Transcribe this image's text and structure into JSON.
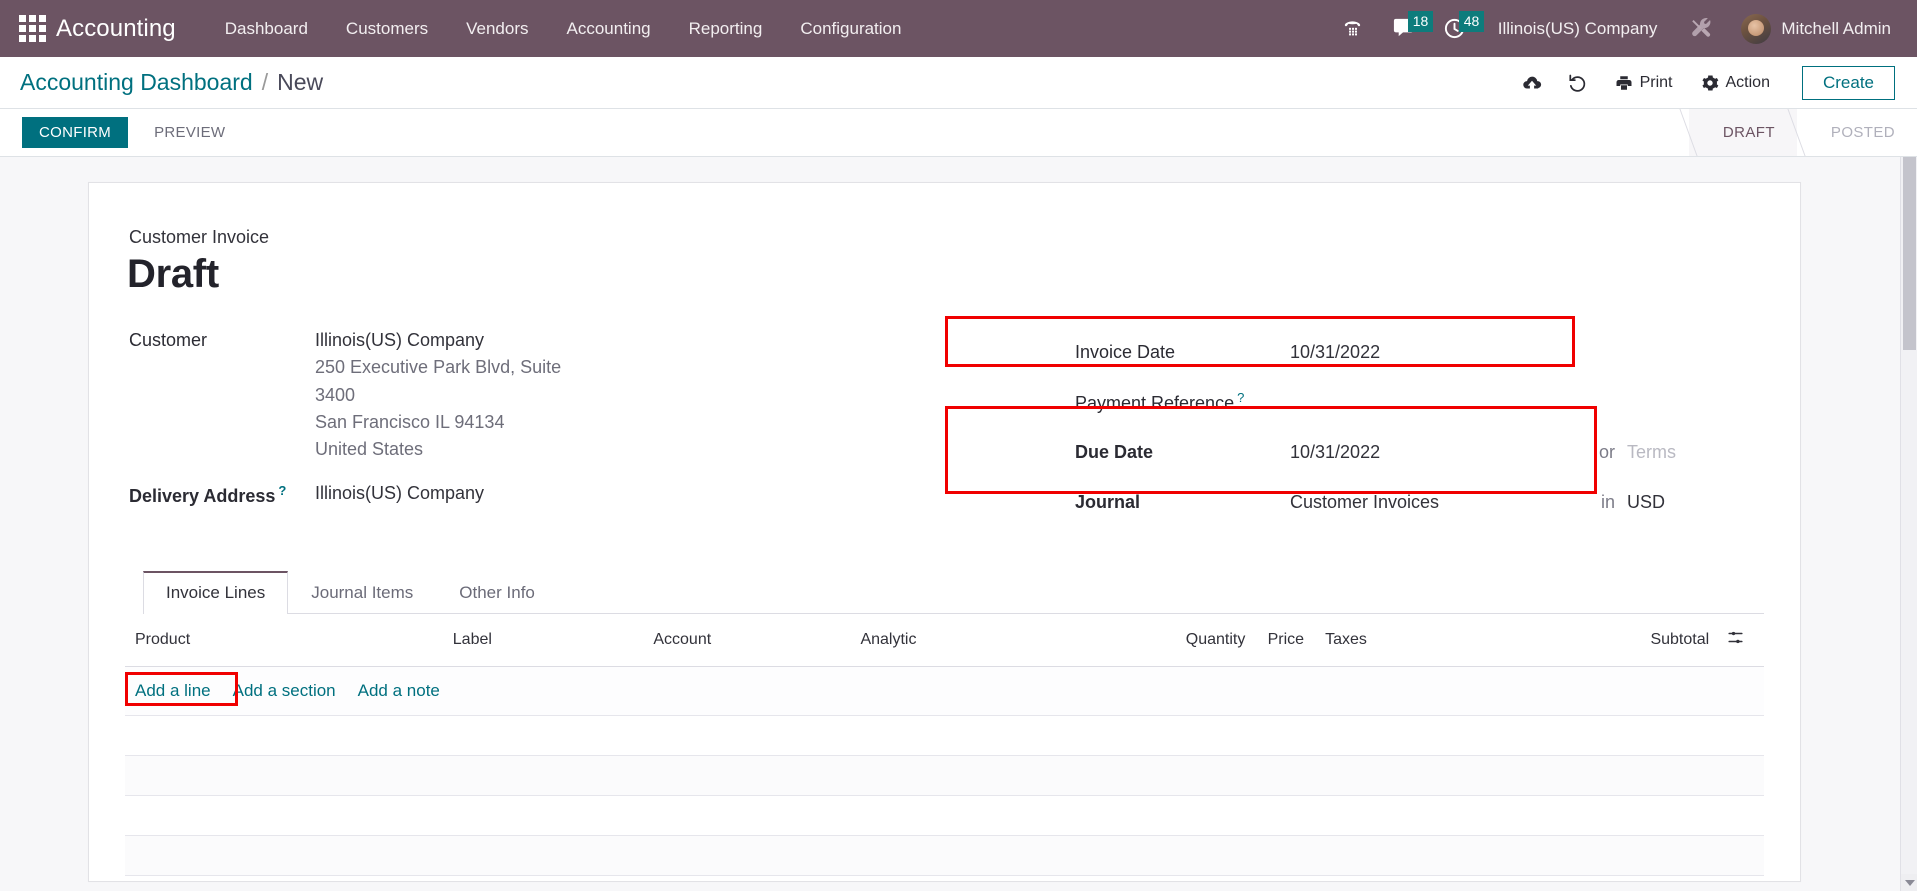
{
  "navbar": {
    "apps_icon": "apps-grid-icon",
    "brand": "Accounting",
    "menu": [
      {
        "label": "Dashboard"
      },
      {
        "label": "Customers"
      },
      {
        "label": "Vendors"
      },
      {
        "label": "Accounting"
      },
      {
        "label": "Reporting"
      },
      {
        "label": "Configuration"
      }
    ],
    "icons": {
      "phone": "phone-dialpad-icon",
      "messages": "chat-bubble-icon",
      "activities": "clock-icon",
      "tools": "tools-wrench-icon"
    },
    "messages_count": "18",
    "activities_count": "48",
    "company": "Illinois(US) Company",
    "user": "Mitchell Admin",
    "bg_color": "#6c5463",
    "badge_color": "#0d7c7c"
  },
  "control_panel": {
    "breadcrumb_root": "Accounting Dashboard",
    "breadcrumb_sep": "/",
    "breadcrumb_current": "New",
    "save_icon": "cloud-upload-icon",
    "discard_icon": "undo-icon",
    "print_label": "Print",
    "print_icon": "printer-icon",
    "action_label": "Action",
    "action_icon": "gear-icon",
    "create_label": "Create",
    "accent_color": "#00707f"
  },
  "statusbar": {
    "confirm_label": "CONFIRM",
    "preview_label": "PREVIEW",
    "stages": [
      {
        "label": "DRAFT",
        "active": true
      },
      {
        "label": "POSTED",
        "active": false
      }
    ]
  },
  "form": {
    "doc_type": "Customer Invoice",
    "doc_state": "Draft",
    "customer_label": "Customer",
    "customer_name": "Illinois(US) Company",
    "customer_address": [
      "250 Executive Park Blvd, Suite",
      "3400",
      "San Francisco IL 94134",
      "United States"
    ],
    "delivery_address_label": "Delivery Address",
    "delivery_address_help": "?",
    "delivery_address_value": "Illinois(US) Company",
    "invoice_date_label": "Invoice Date",
    "invoice_date_value": "10/31/2022",
    "payment_reference_label": "Payment Reference",
    "payment_reference_help": "?",
    "payment_reference_value": "",
    "due_date_label": "Due Date",
    "due_date_value": "10/31/2022",
    "due_date_or": "or",
    "terms_placeholder": "Terms",
    "journal_label": "Journal",
    "journal_value": "Customer Invoices",
    "journal_in": "in",
    "currency_value": "USD",
    "highlight_color": "#f00000"
  },
  "tabs": [
    {
      "label": "Invoice Lines",
      "active": true
    },
    {
      "label": "Journal Items",
      "active": false
    },
    {
      "label": "Other Info",
      "active": false
    }
  ],
  "lines": {
    "columns": [
      "Product",
      "Label",
      "Account",
      "Analytic",
      "Quantity",
      "Price",
      "Taxes",
      "Subtotal"
    ],
    "optional_columns_icon": "sliders-icon",
    "rows": [],
    "add_line_label": "Add a line",
    "add_section_label": "Add a section",
    "add_note_label": "Add a note"
  }
}
